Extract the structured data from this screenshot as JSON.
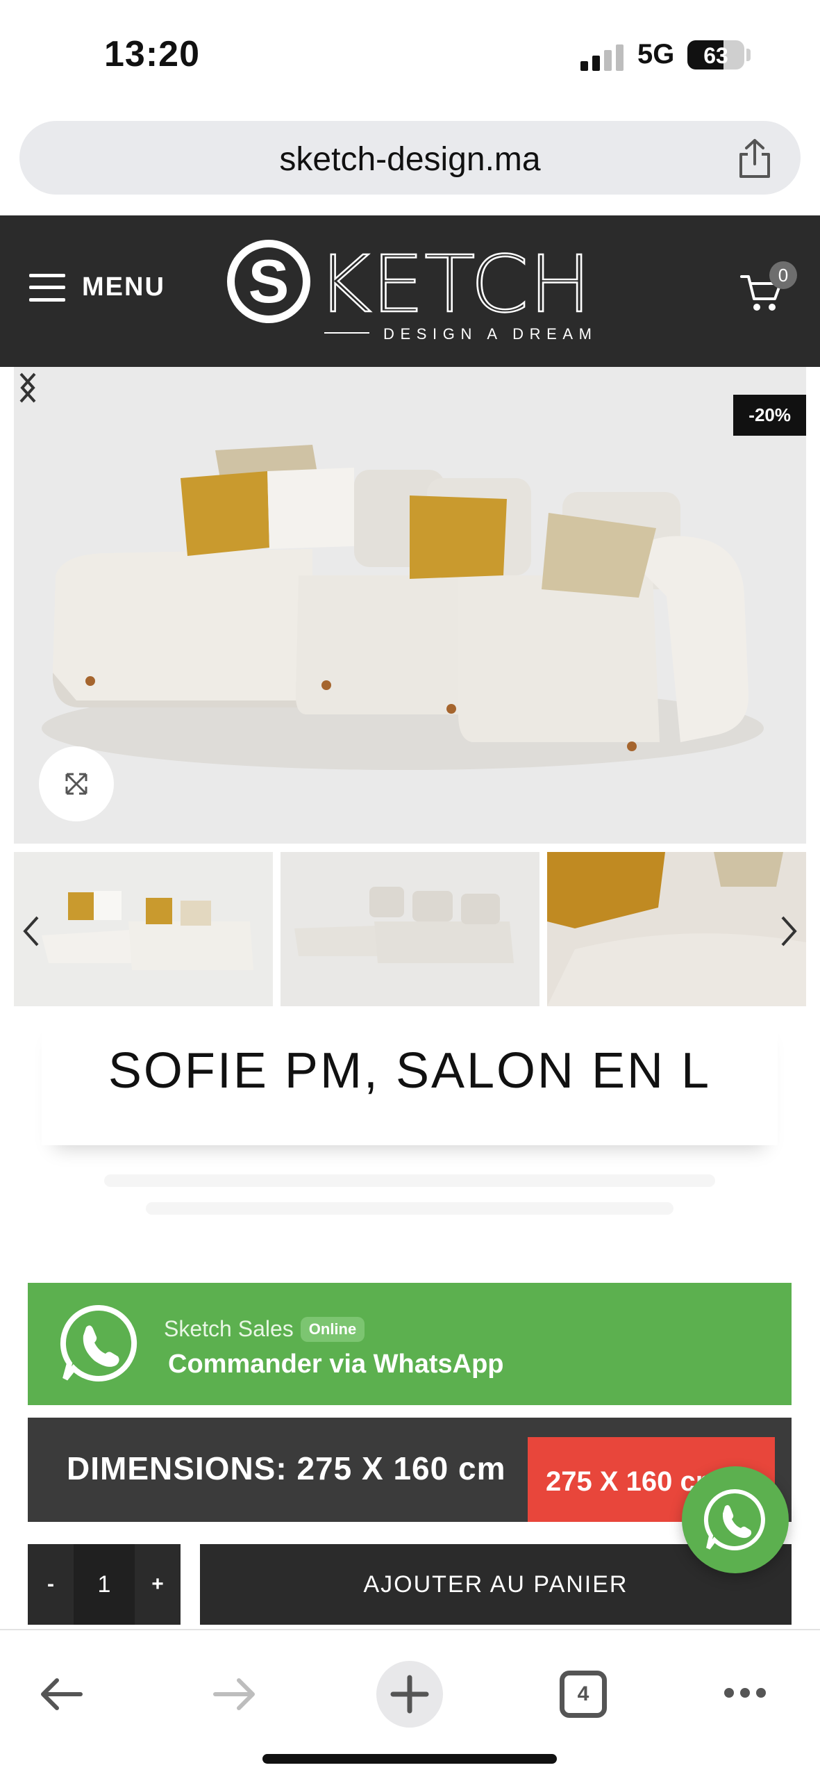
{
  "status_bar": {
    "time": "13:20",
    "network": "5G",
    "battery": "63",
    "battery_level": 0.63
  },
  "browser": {
    "url": "sketch-design.ma",
    "share_icon": "share-icon",
    "open_tabs": "4"
  },
  "header": {
    "menu_label": "MENU",
    "logo_letter": "S",
    "logo_word": "KETCH",
    "logo_tagline": "DESIGN A DREAM",
    "cart_count": "0"
  },
  "gallery": {
    "discount_badge": "-20%",
    "expand_icon": "expand-arrows-icon",
    "thumbnails": [
      "thumbnail-sofa-front",
      "thumbnail-sofa-side",
      "thumbnail-sofa-closeup"
    ]
  },
  "product": {
    "title": "SOFIE PM, SALON EN L"
  },
  "whatsapp": {
    "agent_name": "Sketch Sales",
    "agent_status": "Online",
    "cta": "Commander via WhatsApp",
    "color": "#5cb04f"
  },
  "dimensions": {
    "label": "DIMENSIONS: 275 X 160 cm",
    "selected_option": "275 X 160 cm",
    "option_color": "#e8463b"
  },
  "purchase": {
    "minus": "-",
    "quantity": "1",
    "plus": "+",
    "add_to_cart": "AJOUTER AU PANIER"
  },
  "colors": {
    "header_bg": "#2b2b2b",
    "cushion_mustard": "#c99a2e",
    "sofa_cream": "#ece9e3"
  }
}
